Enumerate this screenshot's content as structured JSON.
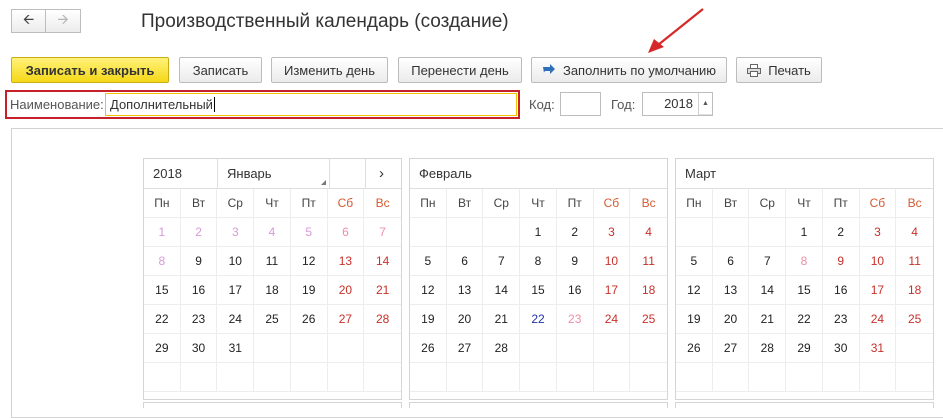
{
  "window": {
    "title": "Производственный календарь (создание)",
    "nav": {
      "back_icon": "arrow-left-icon",
      "forward_icon": "arrow-right-icon"
    }
  },
  "toolbar": {
    "save_close": "Записать и закрыть",
    "save": "Записать",
    "change_day": "Изменить день",
    "move_day": "Перенести день",
    "fill_default": "Заполнить по умолчанию",
    "fill_icon": "fill-arrow-icon",
    "print": "Печать",
    "print_icon": "printer-icon"
  },
  "fields": {
    "name_label": "Наименование:",
    "name_value": "Дополнительный",
    "code_label": "Код:",
    "code_value": "",
    "year_label": "Год:",
    "year_value": "2018"
  },
  "colors": {
    "primary_button": "#f5d817",
    "highlight_border": "#c8202a",
    "weekend": "#c8302a",
    "annotation_arrow": "#d62828"
  },
  "calendar": {
    "weekdays": [
      "Пн",
      "Вт",
      "Ср",
      "Чт",
      "Пт",
      "Сб",
      "Вс"
    ],
    "months": [
      {
        "year": "2018",
        "name": "Январь",
        "next_icon": "›",
        "rows": [
          [
            "1",
            "2",
            "3",
            "4",
            "5",
            "6",
            "7"
          ],
          [
            "8",
            "9",
            "10",
            "11",
            "12",
            "13",
            "14"
          ],
          [
            "15",
            "16",
            "17",
            "18",
            "19",
            "20",
            "21"
          ],
          [
            "22",
            "23",
            "24",
            "25",
            "26",
            "27",
            "28"
          ],
          [
            "29",
            "30",
            "31",
            "",
            "",
            "",
            ""
          ],
          [
            "",
            "",
            "",
            "",
            "",
            "",
            ""
          ]
        ]
      },
      {
        "name": "Февраль",
        "rows": [
          [
            "",
            "",
            "",
            "1",
            "2",
            "3",
            "4"
          ],
          [
            "5",
            "6",
            "7",
            "8",
            "9",
            "10",
            "11"
          ],
          [
            "12",
            "13",
            "14",
            "15",
            "16",
            "17",
            "18"
          ],
          [
            "19",
            "20",
            "21",
            "22",
            "23",
            "24",
            "25"
          ],
          [
            "26",
            "27",
            "28",
            "",
            "",
            "",
            ""
          ],
          [
            "",
            "",
            "",
            "",
            "",
            "",
            ""
          ]
        ]
      },
      {
        "name": "Март",
        "rows": [
          [
            "",
            "",
            "",
            "1",
            "2",
            "3",
            "4"
          ],
          [
            "5",
            "6",
            "7",
            "8",
            "9",
            "10",
            "11"
          ],
          [
            "12",
            "13",
            "14",
            "15",
            "16",
            "17",
            "18"
          ],
          [
            "19",
            "20",
            "21",
            "22",
            "23",
            "24",
            "25"
          ],
          [
            "26",
            "27",
            "28",
            "29",
            "30",
            "31",
            ""
          ],
          [
            "",
            "",
            "",
            "",
            "",
            "",
            ""
          ]
        ]
      }
    ]
  }
}
